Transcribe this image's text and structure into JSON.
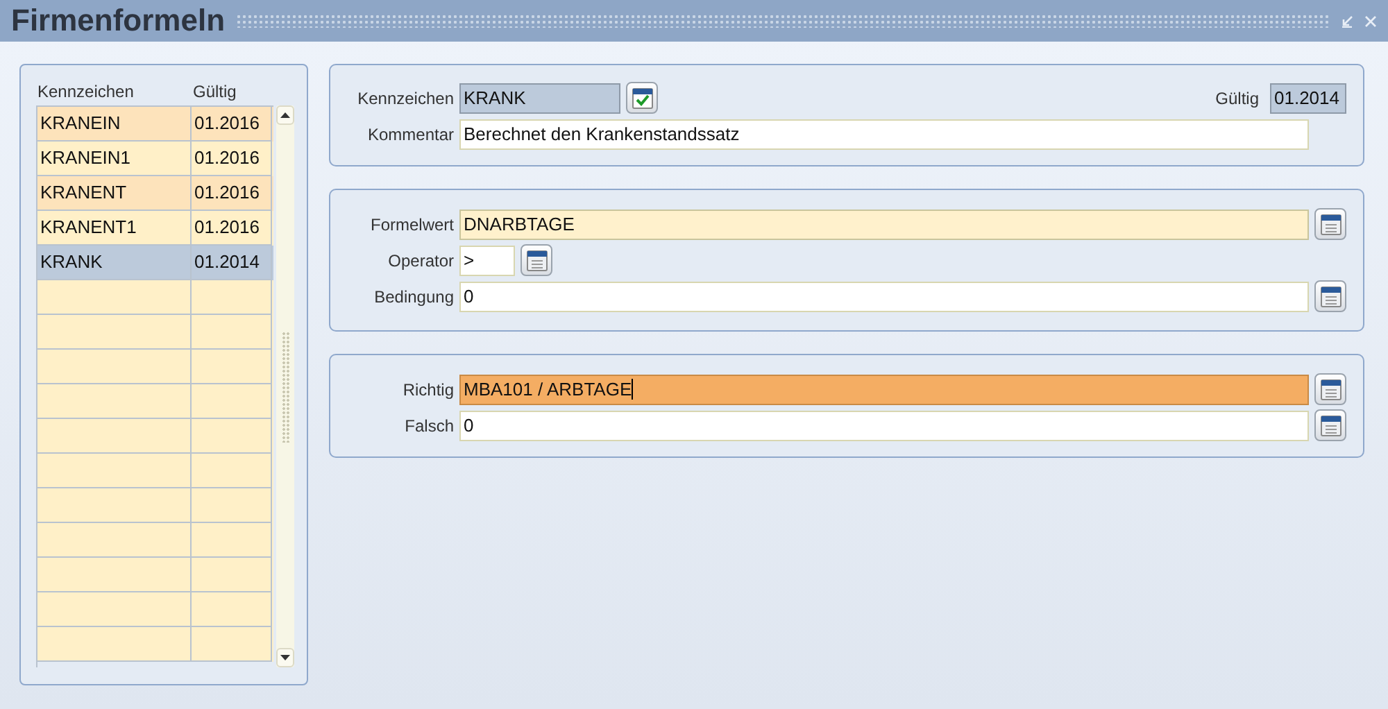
{
  "window": {
    "title": "Firmenformeln"
  },
  "table": {
    "columns": [
      "Kennzeichen",
      "Gültig"
    ],
    "rows": [
      {
        "cells": [
          "KRANEIN",
          "01.2016"
        ],
        "selected": false
      },
      {
        "cells": [
          "KRANEIN1",
          "01.2016"
        ],
        "selected": false
      },
      {
        "cells": [
          "KRANENT",
          "01.2016"
        ],
        "selected": false
      },
      {
        "cells": [
          "KRANENT1",
          "01.2016"
        ],
        "selected": false
      },
      {
        "cells": [
          "KRANK",
          "01.2014"
        ],
        "selected": true
      }
    ]
  },
  "panels": [
    {
      "fields": [
        {
          "label": "Kennzeichen",
          "value": "KRANK",
          "kind": "readonly",
          "check_button": true,
          "extra": {
            "label": "Gültig",
            "value": "01.2014"
          }
        },
        {
          "label": "Kommentar",
          "value": "Berechnet den Krankenstandssatz",
          "kind": "plain"
        }
      ]
    },
    {
      "fields": [
        {
          "label": "Formelwert",
          "value": "DNARBTAGE",
          "kind": "highlight",
          "lookup_button": true
        },
        {
          "label": "Operator",
          "value": ">",
          "kind": "plain",
          "narrow": true,
          "lookup_button": true
        },
        {
          "label": "Bedingung",
          "value": "0",
          "kind": "plain",
          "lookup_button": true
        }
      ]
    },
    {
      "fields": [
        {
          "label": "Richtig",
          "value": "MBA101 / ARBTAGE",
          "kind": "focused",
          "lookup_button": true
        },
        {
          "label": "Falsch",
          "value": "0",
          "kind": "plain",
          "lookup_button": true
        }
      ]
    }
  ]
}
